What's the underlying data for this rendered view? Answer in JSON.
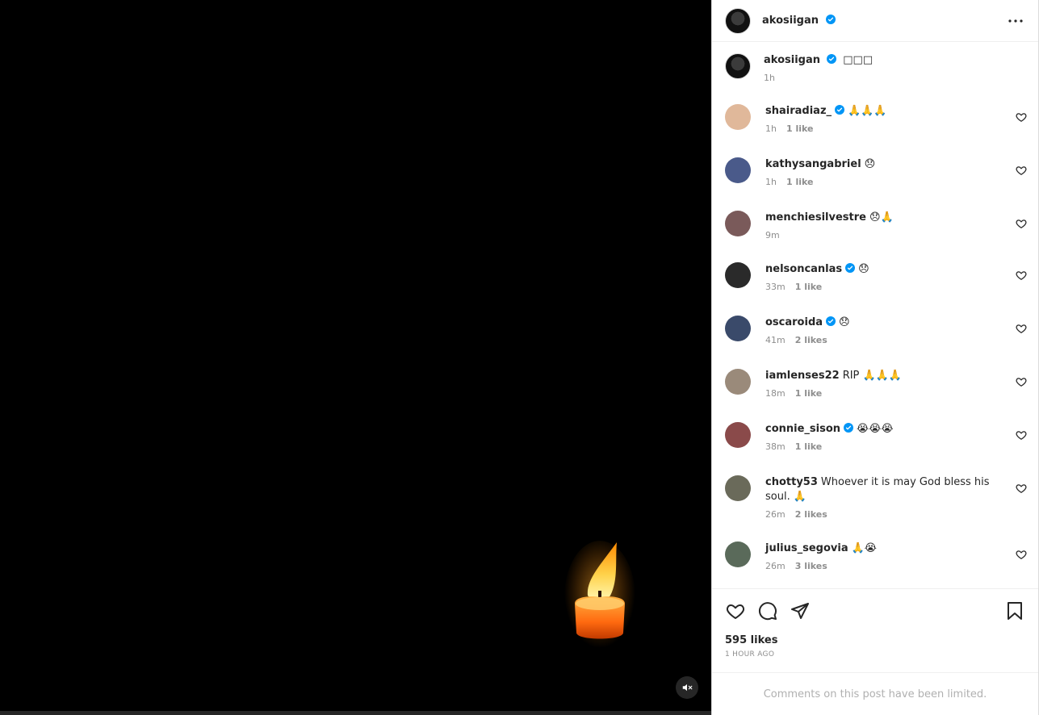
{
  "post": {
    "author": "akosiigan",
    "caption_text": "□□□",
    "caption_time": "1h",
    "likes": "595 likes",
    "time_ago": "1 HOUR AGO",
    "comments_limited": "Comments on this post have been limited."
  },
  "colors": {
    "verified": "#0095f6",
    "meta": "#8e8e8e",
    "media_bg": "#000000"
  },
  "comments": [
    {
      "user": "shairadiaz_",
      "verified": true,
      "text": "🙏🙏🙏",
      "time": "1h",
      "likes": "1 like",
      "avatar": "#e0b89a"
    },
    {
      "user": "kathysangabriel",
      "verified": false,
      "text": "😞",
      "time": "1h",
      "likes": "1 like",
      "avatar": "#4a5a8a"
    },
    {
      "user": "menchiesilvestre",
      "verified": false,
      "text": "😞🙏",
      "time": "9m",
      "likes": "",
      "avatar": "#7a5a5a"
    },
    {
      "user": "nelsoncanlas",
      "verified": true,
      "text": "😞",
      "time": "33m",
      "likes": "1 like",
      "avatar": "#2a2a2a"
    },
    {
      "user": "oscaroida",
      "verified": true,
      "text": "😞",
      "time": "41m",
      "likes": "2 likes",
      "avatar": "#3a4a6a"
    },
    {
      "user": "iamlenses22",
      "verified": false,
      "text": "RIP 🙏🙏🙏",
      "time": "18m",
      "likes": "1 like",
      "avatar": "#9a8a7a"
    },
    {
      "user": "connie_sison",
      "verified": true,
      "text": "😭😭😭",
      "time": "38m",
      "likes": "1 like",
      "avatar": "#8a4a4a"
    },
    {
      "user": "chotty53",
      "verified": false,
      "text": "Whoever it is may God bless his soul. 🙏",
      "time": "26m",
      "likes": "2 likes",
      "avatar": "#6a6a5a"
    },
    {
      "user": "julius_segovia",
      "verified": false,
      "text": "🙏😭",
      "time": "26m",
      "likes": "3 likes",
      "avatar": "#5a6a5a"
    }
  ]
}
